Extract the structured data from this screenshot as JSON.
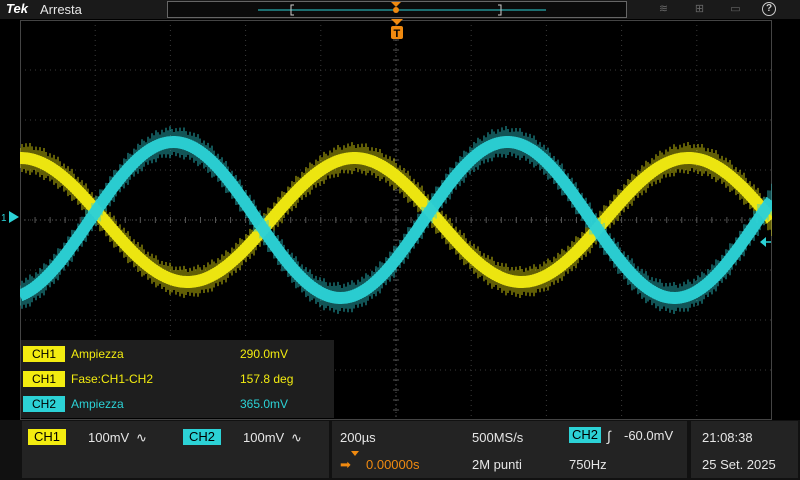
{
  "topbar": {
    "brand": "Tek",
    "state": "Arresta",
    "help": "?"
  },
  "graticule": {
    "ch1_marker": "1",
    "trigger_marker": "T"
  },
  "measurements": [
    {
      "channel": "CH1",
      "name": "Ampiezza",
      "value": "290.0mV",
      "color": "#f3ec10"
    },
    {
      "channel": "CH1",
      "name": "Fase:CH1-CH2",
      "value": "157.8 deg",
      "color": "#f3ec10"
    },
    {
      "channel": "CH2",
      "name": "Ampiezza",
      "value": "365.0mV",
      "color": "#2cd2d6"
    }
  ],
  "channels": {
    "ch1": {
      "label": "CH1",
      "scale": "100mV",
      "coupling": "∿",
      "color": "#f3ec10"
    },
    "ch2": {
      "label": "CH2",
      "scale": "100mV",
      "coupling": "∿",
      "color": "#2cd2d6"
    }
  },
  "horizontal": {
    "scale": "200µs",
    "position": "0.00000s",
    "sample_rate": "500MS/s",
    "record_length": "2M punti"
  },
  "trigger": {
    "source": "CH2",
    "slope": "∫",
    "level": "-60.0mV",
    "frequency": "750Hz"
  },
  "clock": {
    "time": "21:08:38",
    "date": "25 Set. 2025"
  }
}
